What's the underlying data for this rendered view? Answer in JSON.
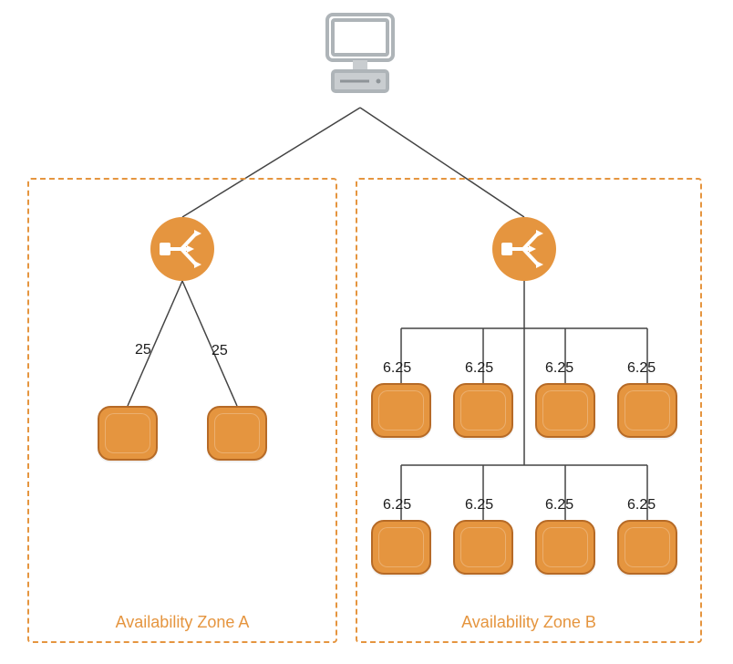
{
  "zoneA": {
    "label": "Availability Zone A",
    "targets": [
      {
        "weight": "25"
      },
      {
        "weight": "25"
      }
    ]
  },
  "zoneB": {
    "label": "Availability Zone B",
    "targets": [
      {
        "weight": "6.25"
      },
      {
        "weight": "6.25"
      },
      {
        "weight": "6.25"
      },
      {
        "weight": "6.25"
      },
      {
        "weight": "6.25"
      },
      {
        "weight": "6.25"
      },
      {
        "weight": "6.25"
      },
      {
        "weight": "6.25"
      }
    ]
  }
}
